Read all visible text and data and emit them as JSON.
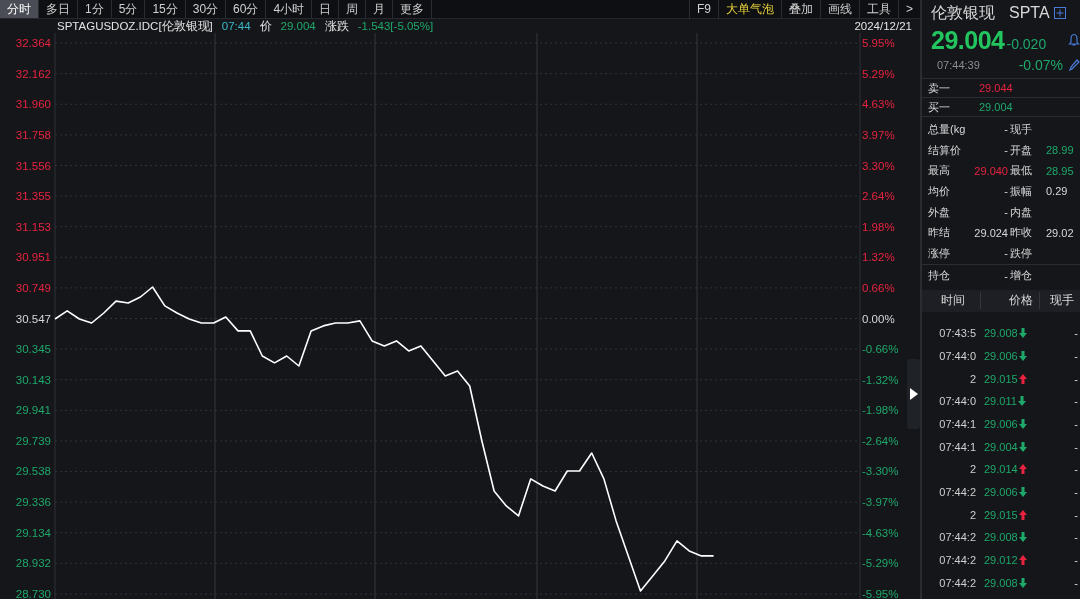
{
  "toolbar": {
    "periods": [
      {
        "label": "分时",
        "selected": true
      },
      {
        "label": "多日",
        "selected": false
      },
      {
        "label": "1分",
        "selected": false
      },
      {
        "label": "5分",
        "selected": false
      },
      {
        "label": "15分",
        "selected": false
      },
      {
        "label": "30分",
        "selected": false
      },
      {
        "label": "60分",
        "selected": false
      },
      {
        "label": "4小时",
        "selected": false
      },
      {
        "label": "日",
        "selected": false
      },
      {
        "label": "周",
        "selected": false
      },
      {
        "label": "月",
        "selected": false
      },
      {
        "label": "更多",
        "selected": false
      }
    ],
    "tools": [
      {
        "label": "F9",
        "highlighted": false
      },
      {
        "label": "大单气泡",
        "highlighted": true
      },
      {
        "label": "叠加",
        "highlighted": false
      },
      {
        "label": "画线",
        "highlighted": false
      },
      {
        "label": "工具",
        "highlighted": false
      },
      {
        "label": ">",
        "highlighted": false
      }
    ]
  },
  "info_bar": {
    "symbol": "SPTAGUSDOZ.IDC[伦敦银现]",
    "time": "07:44",
    "price_label": "价",
    "price": "29.004",
    "change_label": "涨跌",
    "change": "-1.543[-5.05%]",
    "date": "2024/12/21"
  },
  "chart": {
    "percent_labels": [
      "5.95%",
      "5.29%",
      "4.63%",
      "3.97%",
      "3.30%",
      "2.64%",
      "1.98%",
      "1.32%",
      "0.66%",
      "0.00%",
      "-0.66%",
      "-1.32%",
      "-1.98%",
      "-2.64%",
      "-3.30%",
      "-3.97%",
      "-4.63%",
      "-5.29%",
      "-5.95%"
    ],
    "chart_data": {
      "type": "line",
      "grid": true,
      "ylim": [
        28.73,
        32.364
      ],
      "yticks": [
        {
          "value": 32.364,
          "label": "32.364"
        },
        {
          "value": 32.162,
          "label": "32.162"
        },
        {
          "value": 31.96,
          "label": "31.960"
        },
        {
          "value": 31.758,
          "label": "31.758"
        },
        {
          "value": 31.556,
          "label": "31.556"
        },
        {
          "value": 31.355,
          "label": "31.355"
        },
        {
          "value": 31.153,
          "label": "31.153"
        },
        {
          "value": 30.951,
          "label": "30.951"
        },
        {
          "value": 30.749,
          "label": "30.749"
        },
        {
          "value": 30.547,
          "label": "30.547"
        },
        {
          "value": 30.345,
          "label": "30.345"
        },
        {
          "value": 30.143,
          "label": "30.143"
        },
        {
          "value": 29.941,
          "label": "29.941"
        },
        {
          "value": 29.739,
          "label": "29.739"
        },
        {
          "value": 29.538,
          "label": "29.538"
        },
        {
          "value": 29.336,
          "label": "29.336"
        },
        {
          "value": 29.134,
          "label": "29.134"
        },
        {
          "value": 28.932,
          "label": "28.932"
        },
        {
          "value": 28.73,
          "label": "28.730"
        }
      ],
      "series": [
        {
          "color": "#ffffff",
          "values": [
            30.544,
            30.597,
            30.544,
            30.517,
            30.583,
            30.662,
            30.649,
            30.689,
            30.755,
            30.63,
            30.583,
            30.544,
            30.517,
            30.517,
            30.557,
            30.465,
            30.465,
            30.3,
            30.254,
            30.3,
            30.234,
            30.465,
            30.498,
            30.517,
            30.517,
            30.531,
            30.399,
            30.366,
            30.399,
            30.333,
            30.366,
            30.267,
            30.168,
            30.201,
            30.102,
            29.739,
            29.409,
            29.311,
            29.245,
            29.489,
            29.442,
            29.409,
            29.541,
            29.541,
            29.66,
            29.489,
            29.212,
            28.981,
            28.75,
            28.849,
            28.948,
            29.08,
            29.014,
            28.981,
            28.981,
            null,
            null,
            null,
            null,
            null,
            null,
            null,
            null,
            null,
            null,
            null,
            null
          ]
        }
      ]
    }
  },
  "quote": {
    "name": "伦敦银现",
    "code": "SPTA",
    "price": "29.004",
    "change": "-0.020",
    "time": "07:44:39",
    "change_pct": "-0.07%",
    "ask": {
      "label": "卖一",
      "value": "29.044"
    },
    "bid": {
      "label": "买一",
      "value": "29.004"
    },
    "stats": [
      {
        "cells": [
          {
            "label": "总量(kg",
            "value": "-"
          },
          {
            "label": "现手"
          }
        ]
      },
      {
        "cells": [
          {
            "label": "结算价",
            "value": "-"
          },
          {
            "label": "开盘",
            "value": "28.99",
            "color": "#1fa86a"
          }
        ]
      },
      {
        "cells": [
          {
            "label": "最高",
            "value": "29.040",
            "color": "#e8233f"
          },
          {
            "label": "最低",
            "value": "28.95",
            "color": "#1fa86a"
          }
        ]
      },
      {
        "cells": [
          {
            "label": "均价",
            "value": "-"
          },
          {
            "label": "振幅",
            "value": "0.29"
          }
        ]
      },
      {
        "cells": [
          {
            "label": "外盘",
            "value": "-"
          },
          {
            "label": "内盘"
          }
        ]
      },
      {
        "cells": [
          {
            "label": "昨结",
            "value": "29.024"
          },
          {
            "label": "昨收",
            "value": "29.02"
          }
        ]
      },
      {
        "cells": [
          {
            "label": "涨停",
            "value": "-"
          },
          {
            "label": "跌停"
          }
        ]
      }
    ],
    "position": {
      "label": "持仓",
      "value": "-",
      "label2": "增仓"
    }
  },
  "ticks": {
    "columns": [
      "时间",
      "价格",
      "现手"
    ],
    "rows": [
      {
        "time": "07:43:5",
        "price": "29.008",
        "kind": "down",
        "volume": "-"
      },
      {
        "time": "07:44:0",
        "price": "29.006",
        "kind": "down",
        "volume": "-"
      },
      {
        "time": "2",
        "price": "29.015",
        "kind": "up",
        "volume": "-"
      },
      {
        "time": "07:44:0",
        "price": "29.011",
        "kind": "down",
        "volume": "-"
      },
      {
        "time": "07:44:1",
        "price": "29.006",
        "kind": "down",
        "volume": "-"
      },
      {
        "time": "07:44:1",
        "price": "29.004",
        "kind": "down",
        "volume": "-"
      },
      {
        "time": "2",
        "price": "29.014",
        "kind": "up",
        "volume": "-"
      },
      {
        "time": "07:44:2",
        "price": "29.006",
        "kind": "down",
        "volume": "-"
      },
      {
        "time": "2",
        "price": "29.015",
        "kind": "up",
        "volume": "-"
      },
      {
        "time": "07:44:2",
        "price": "29.008",
        "kind": "down",
        "volume": "-"
      },
      {
        "time": "07:44:2",
        "price": "29.012",
        "kind": "up",
        "volume": "-"
      },
      {
        "time": "07:44:2",
        "price": "29.008",
        "kind": "down",
        "volume": "-"
      }
    ]
  }
}
